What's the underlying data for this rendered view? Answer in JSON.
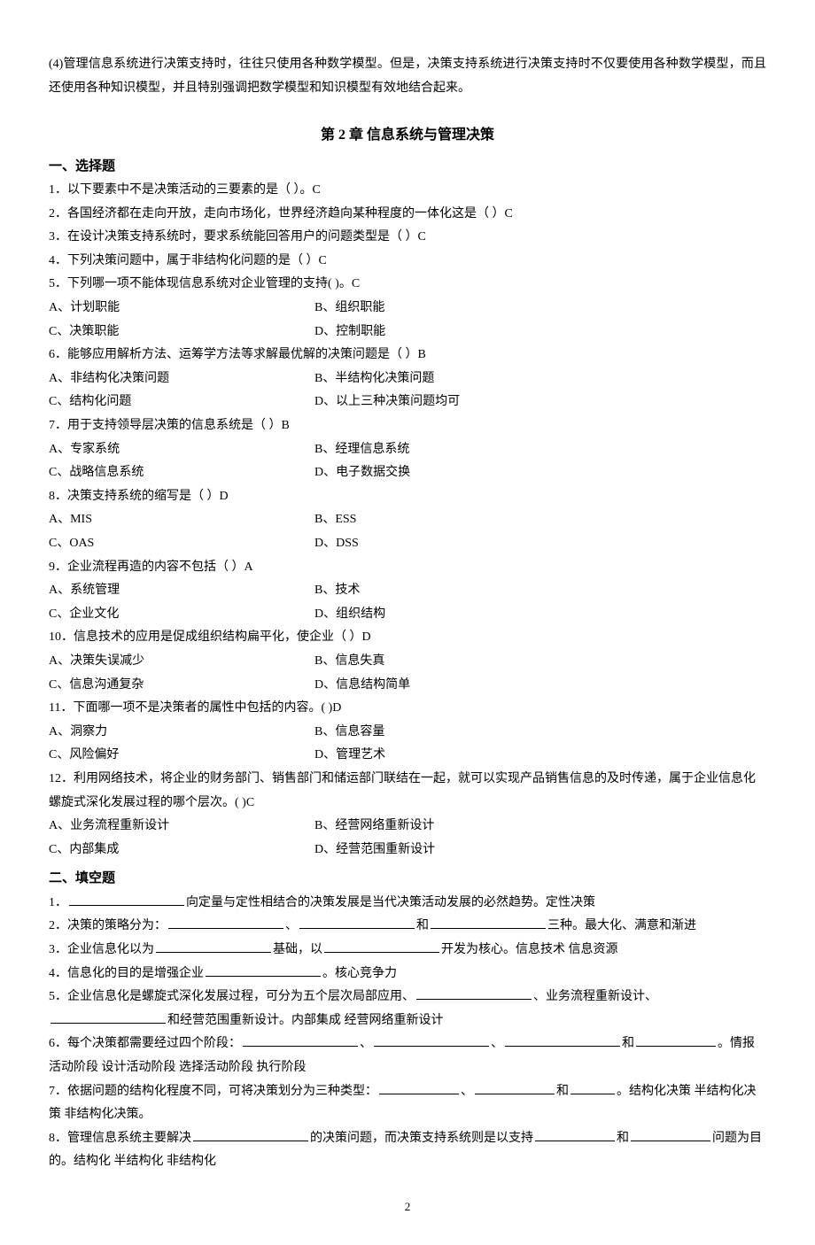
{
  "intro_para": "(4)管理信息系统进行决策支持时，往往只使用各种数学模型。但是，决策支持系统进行决策支持时不仅要使用各种数学模型，而且还使用各种知识模型，并且特别强调把数学模型和知识模型有效地结合起来。",
  "chapter_title": "第 2 章   信息系统与管理决策",
  "section1_title": "一、选择题",
  "q1": "1．以下要素中不是决策活动的三要素的是（            ）。C",
  "q2": "2．各国经济都在走向开放，走向市场化，世界经济趋向某种程度的一体化这是（   ）C",
  "q3": "3．在设计决策支持系统时，要求系统能回答用户的问题类型是（ ）C",
  "q4": "4．下列决策问题中，属于非结构化问题的是（ ）C",
  "q5": "5．下列哪一项不能体现信息系统对企业管理的支持(     )。C",
  "q5_a": "A、计划职能",
  "q5_b": "B、组织职能",
  "q5_c": "C、决策职能",
  "q5_d": "D、控制职能",
  "q6": "6．能够应用解析方法、运筹学方法等求解最优解的决策问题是（ ）B",
  "q6_a": "A、非结构化决策问题",
  "q6_b": "B、半结构化决策问题",
  "q6_c": "C、结构化问题",
  "q6_d": "D、以上三种决策问题均可",
  "q7": "7．用于支持领导层决策的信息系统是（ ）B",
  "q7_a": "A、专家系统",
  "q7_b": "B、经理信息系统",
  "q7_c": "C、战略信息系统",
  "q7_d": "D、电子数据交换",
  "q8": "8．决策支持系统的缩写是（   ）D",
  "q8_a": "A、MIS",
  "q8_b": "B、ESS",
  "q8_c": "C、OAS",
  "q8_d": "D、DSS",
  "q9": "9．企业流程再造的内容不包括（   ）A",
  "q9_a": "A、系统管理",
  "q9_b": "B、技术",
  "q9_c": "C、企业文化",
  "q9_d": "D、组织结构",
  "q10": "10．信息技术的应用是促成组织结构扁平化，使企业（   ）D",
  "q10_a": "A、决策失误减少",
  "q10_b": "B、信息失真",
  "q10_c": "C、信息沟通复杂",
  "q10_d": "D、信息结构简单",
  "q11": "11．下面哪一项不是决策者的属性中包括的内容。(         )D",
  "q11_a": "A、洞察力",
  "q11_b": "B、信息容量",
  "q11_c": "C、风险偏好",
  "q11_d": "D、管理艺术",
  "q12": "12．利用网络技术，将企业的财务部门、销售部门和储运部门联结在一起，就可以实现产品销售信息的及时传递，属于企业信息化螺旋式深化发展过程的哪个层次。(         )C",
  "q12_a": "A、业务流程重新设计",
  "q12_b": "B、经营网络重新设计",
  "q12_c": "C、内部集成",
  "q12_d": "D、经营范围重新设计",
  "section2_title": "二、填空题",
  "f1_a": "1．",
  "f1_b": "向定量与定性相结合的决策发展是当代决策活动发展的必然趋势。定性决策",
  "f2_a": "2．决策的策略分为：",
  "f2_b": "、",
  "f2_c": "和",
  "f2_d": "三种。最大化、满意和渐进",
  "f3_a": "3．企业信息化以为",
  "f3_b": "基础，以",
  "f3_c": "开发为核心。信息技术   信息资源",
  "f4_a": "4．信息化的目的是增强企业",
  "f4_b": "。核心竞争力",
  "f5_a": "5．企业信息化是螺旋式深化发展过程，可分为五个层次局部应用、",
  "f5_b": "、业务流程重新设计、",
  "f5_c": "和经营范围重新设计。内部集成   经营网络重新设计",
  "f6_a": "6．每个决策都需要经过四个阶段：",
  "f6_b": "、",
  "f6_c": "、",
  "f6_d": "和",
  "f6_e": "。情报活动阶段   设计活动阶段   选择活动阶段   执行阶段",
  "f7_a": "7．依据问题的结构化程度不同，可将决策划分为三种类型：",
  "f7_b": "、",
  "f7_c": "和",
  "f7_d": "。结构化决策   半结构化决策   非结构化决策。",
  "f8_a": "8．管理信息系统主要解决",
  "f8_b": "的决策问题，而决策支持系统则是以支持",
  "f8_c": "和",
  "f8_d": "问题为目的。结构化     半结构化     非结构化",
  "page_num": "2"
}
